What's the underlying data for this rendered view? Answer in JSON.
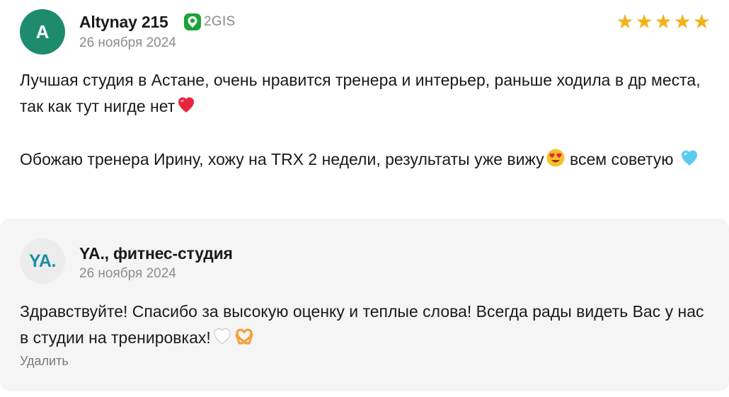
{
  "review": {
    "avatar_letter": "A",
    "author": "Altynay 215",
    "source": {
      "label": "2GIS",
      "icon": "2gis-pin-icon",
      "color": "#1ba336"
    },
    "date": "26 ноября 2024",
    "rating": 5,
    "rating_color": "#f2b21a",
    "avatar_color": "#1e8a6e",
    "text_line1": "Лучшая студия в Астане, очень нравится тренера и интерьер, раньше ходила в др места, так как тут нигде нет",
    "text_line2a": "Обожаю тренера Ирину, хожу на TRX 2 недели, результаты уже вижу",
    "text_line2b": " всем советую "
  },
  "reply": {
    "avatar_text": "YA.",
    "author": "YA., фитнес-студия",
    "date": "26 ноября 2024",
    "text": "Здравствуйте! Спасибо за высокую оценку и теплые слова! Всегда рады видеть Вас у нас в студии на тренировках!",
    "delete_label": "Удалить",
    "brand_color": "#1b8fa0"
  }
}
